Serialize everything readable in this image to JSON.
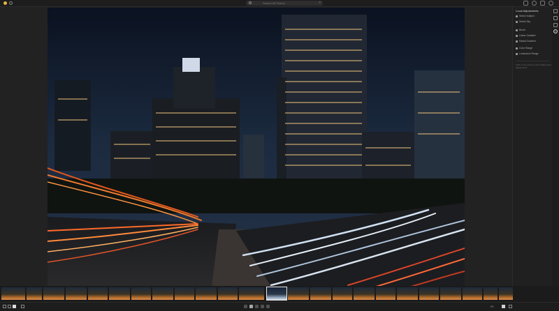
{
  "search": {
    "placeholder": "Search All Photos"
  },
  "panel": {
    "title": "Local Adjustments",
    "items": [
      {
        "label": "Select Subject",
        "icon": "person-icon"
      },
      {
        "label": "Select Sky",
        "icon": "cloud-icon"
      },
      {
        "label": "Brush",
        "icon": "brush-icon"
      },
      {
        "label": "Linear Gradient",
        "icon": "gradient-icon"
      },
      {
        "label": "Radial Gradient",
        "icon": "radial-icon"
      },
      {
        "label": "Color Range",
        "icon": "color-range-icon"
      },
      {
        "label": "Luminance Range",
        "icon": "luminance-icon"
      }
    ],
    "note": "Click on the photo to start adding local adjustments."
  },
  "statusbar": {
    "zoom": "Fit"
  },
  "colors": {
    "accent": "#e4b73a",
    "background": "#232323"
  }
}
